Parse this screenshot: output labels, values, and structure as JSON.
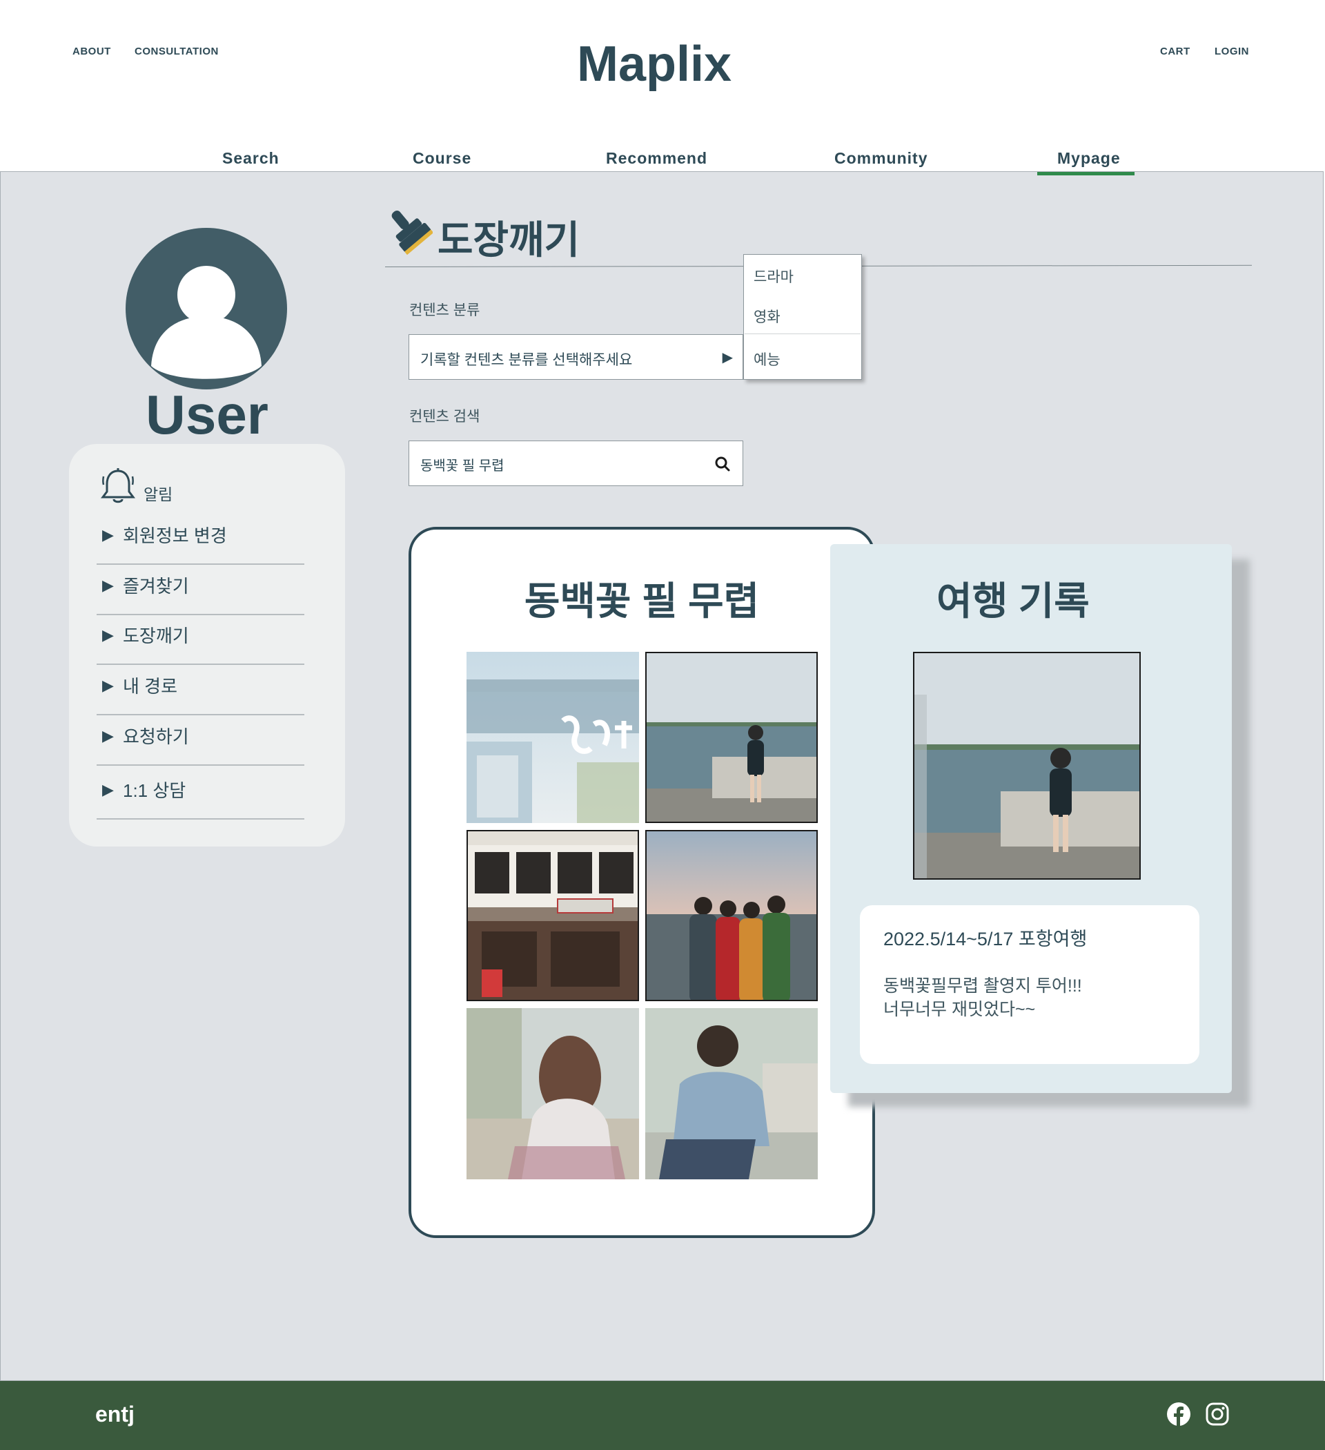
{
  "header": {
    "top_left_links": [
      "ABOUT",
      "CONSULTATION"
    ],
    "top_right_links": [
      "CART",
      "LOGIN"
    ],
    "logo": "Maplix"
  },
  "nav": {
    "items": [
      "Search",
      "Course",
      "Recommend",
      "Community",
      "Mypage"
    ],
    "active": "Mypage"
  },
  "profile": {
    "name": "User"
  },
  "sidebar": {
    "alarm_label": "알림",
    "items": [
      "회원정보 변경",
      "즐겨찾기",
      "도장깨기",
      "내 경로",
      "요청하기",
      "1:1 상담"
    ]
  },
  "stamp": {
    "title": "도장깨기",
    "category_label": "컨텐츠 분류",
    "category_value": "기록할 컨텐츠 분류를 선택해주세요",
    "category_options": [
      "드라마",
      "영화",
      "예능"
    ],
    "search_label": "컨텐츠 검색",
    "search_value": "동백꽃 필 무렵"
  },
  "content_card": {
    "title": "동백꽃 필 무렵"
  },
  "record_card": {
    "title": "여행 기록",
    "date": "2022.5/14~5/17 포항여행",
    "text_lines": [
      "동백꽃필무렵 촬영지 투어!!!",
      "너무너무 재밋었다~~"
    ]
  },
  "footer": {
    "brand": "entj",
    "social_icons": [
      "facebook-icon",
      "instagram-icon"
    ]
  },
  "colors": {
    "primary": "#2e4a56",
    "background": "#dfe2e6",
    "accent_green": "#2f8a4b",
    "footer": "#3a5a3d"
  }
}
